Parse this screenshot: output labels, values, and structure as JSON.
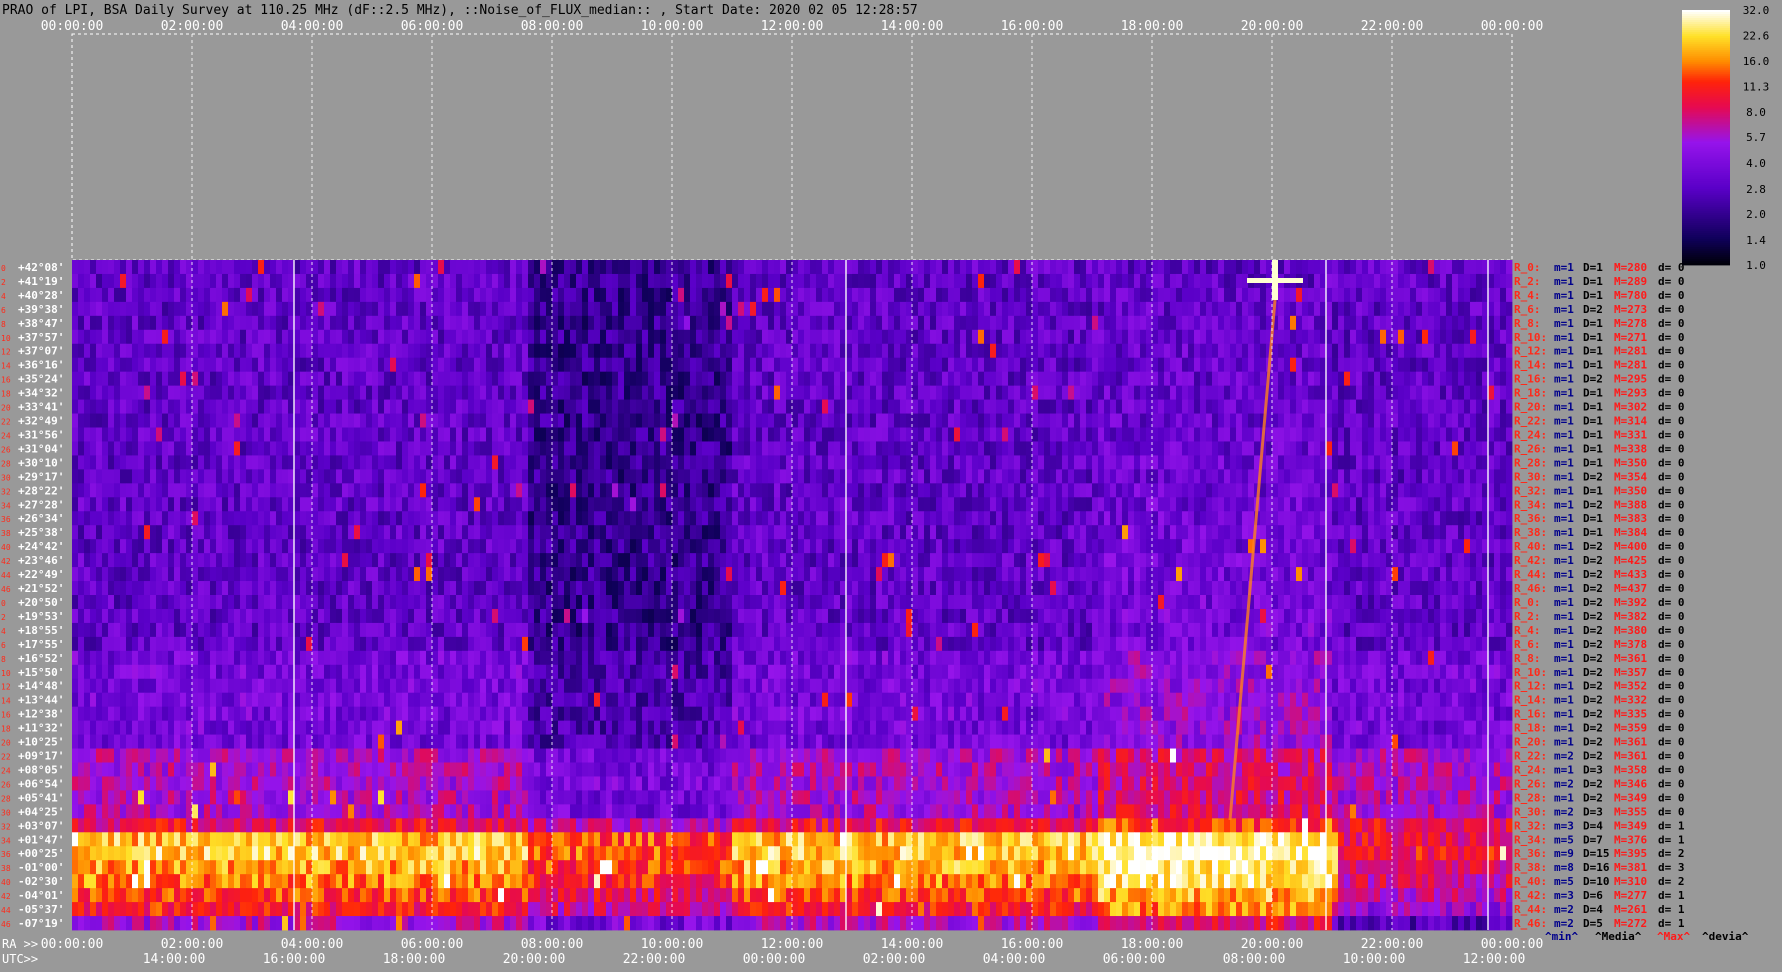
{
  "chart_data": {
    "type": "heatmap",
    "title": "PRAO of LPI, BSA Daily Survey at 110.25 MHz (dF::2.5 MHz), ::Noise_of_FLUX_median:: , Start Date: 2020 02 05 12:28:57",
    "ra_axis_label": "RA >>",
    "utc_axis_label": "UTC>>",
    "x_ticks_top": [
      "00:00:00",
      "02:00:00",
      "04:00:00",
      "06:00:00",
      "08:00:00",
      "10:00:00",
      "12:00:00",
      "14:00:00",
      "16:00:00",
      "18:00:00",
      "20:00:00",
      "22:00:00",
      "00:00:00"
    ],
    "x_ticks_ra": [
      "00:00:00",
      "02:00:00",
      "04:00:00",
      "06:00:00",
      "08:00:00",
      "10:00:00",
      "12:00:00",
      "14:00:00",
      "16:00:00",
      "18:00:00",
      "20:00:00",
      "22:00:00",
      "00:00:00"
    ],
    "x_ticks_utc": [
      "14:00:00",
      "16:00:00",
      "18:00:00",
      "20:00:00",
      "22:00:00",
      "00:00:00",
      "02:00:00",
      "04:00:00",
      "06:00:00",
      "08:00:00",
      "10:00:00",
      "12:00:00"
    ],
    "ra_range_hours": [
      0,
      24
    ],
    "colorbar": {
      "ticks": [
        "32.0",
        "22.6",
        "16.0",
        "11.3",
        "8.0",
        "5.7",
        "4.0",
        "2.8",
        "2.0",
        "1.4",
        "1.0"
      ],
      "range": [
        1.0,
        32.0
      ],
      "scale": "log"
    },
    "rows": [
      {
        "idx": "0",
        "dec": "+42°08'",
        "name": "R_0:",
        "m": "m=1",
        "D": "D=1",
        "M": "M=280",
        "d": "d= 0"
      },
      {
        "idx": "2",
        "dec": "+41°19'",
        "name": "R_2:",
        "m": "m=1",
        "D": "D=1",
        "M": "M=289",
        "d": "d= 0"
      },
      {
        "idx": "4",
        "dec": "+40°28'",
        "name": "R_4:",
        "m": "m=1",
        "D": "D=1",
        "M": "M=780",
        "d": "d= 0"
      },
      {
        "idx": "6",
        "dec": "+39°38'",
        "name": "R_6:",
        "m": "m=1",
        "D": "D=2",
        "M": "M=273",
        "d": "d= 0"
      },
      {
        "idx": "8",
        "dec": "+38°47'",
        "name": "R_8:",
        "m": "m=1",
        "D": "D=1",
        "M": "M=278",
        "d": "d= 0"
      },
      {
        "idx": "10",
        "dec": "+37°57'",
        "name": "R_10:",
        "m": "m=1",
        "D": "D=1",
        "M": "M=271",
        "d": "d= 0"
      },
      {
        "idx": "12",
        "dec": "+37°07'",
        "name": "R_12:",
        "m": "m=1",
        "D": "D=1",
        "M": "M=281",
        "d": "d= 0"
      },
      {
        "idx": "14",
        "dec": "+36°16'",
        "name": "R_14:",
        "m": "m=1",
        "D": "D=1",
        "M": "M=281",
        "d": "d= 0"
      },
      {
        "idx": "16",
        "dec": "+35°24'",
        "name": "R_16:",
        "m": "m=1",
        "D": "D=2",
        "M": "M=295",
        "d": "d= 0"
      },
      {
        "idx": "18",
        "dec": "+34°32'",
        "name": "R_18:",
        "m": "m=1",
        "D": "D=1",
        "M": "M=293",
        "d": "d= 0"
      },
      {
        "idx": "20",
        "dec": "+33°41'",
        "name": "R_20:",
        "m": "m=1",
        "D": "D=1",
        "M": "M=302",
        "d": "d= 0"
      },
      {
        "idx": "22",
        "dec": "+32°49'",
        "name": "R_22:",
        "m": "m=1",
        "D": "D=1",
        "M": "M=314",
        "d": "d= 0"
      },
      {
        "idx": "24",
        "dec": "+31°56'",
        "name": "R_24:",
        "m": "m=1",
        "D": "D=1",
        "M": "M=331",
        "d": "d= 0"
      },
      {
        "idx": "26",
        "dec": "+31°04'",
        "name": "R_26:",
        "m": "m=1",
        "D": "D=1",
        "M": "M=338",
        "d": "d= 0"
      },
      {
        "idx": "28",
        "dec": "+30°10'",
        "name": "R_28:",
        "m": "m=1",
        "D": "D=1",
        "M": "M=350",
        "d": "d= 0"
      },
      {
        "idx": "30",
        "dec": "+29°17'",
        "name": "R_30:",
        "m": "m=1",
        "D": "D=2",
        "M": "M=354",
        "d": "d= 0"
      },
      {
        "idx": "32",
        "dec": "+28°22'",
        "name": "R_32:",
        "m": "m=1",
        "D": "D=1",
        "M": "M=350",
        "d": "d= 0"
      },
      {
        "idx": "34",
        "dec": "+27°28'",
        "name": "R_34:",
        "m": "m=1",
        "D": "D=2",
        "M": "M=388",
        "d": "d= 0"
      },
      {
        "idx": "36",
        "dec": "+26°34'",
        "name": "R_36:",
        "m": "m=1",
        "D": "D=1",
        "M": "M=383",
        "d": "d= 0"
      },
      {
        "idx": "38",
        "dec": "+25°38'",
        "name": "R_38:",
        "m": "m=1",
        "D": "D=1",
        "M": "M=384",
        "d": "d= 0"
      },
      {
        "idx": "40",
        "dec": "+24°42'",
        "name": "R_40:",
        "m": "m=1",
        "D": "D=2",
        "M": "M=400",
        "d": "d= 0"
      },
      {
        "idx": "42",
        "dec": "+23°46'",
        "name": "R_42:",
        "m": "m=1",
        "D": "D=2",
        "M": "M=425",
        "d": "d= 0"
      },
      {
        "idx": "44",
        "dec": "+22°49'",
        "name": "R_44:",
        "m": "m=1",
        "D": "D=2",
        "M": "M=433",
        "d": "d= 0"
      },
      {
        "idx": "46",
        "dec": "+21°52'",
        "name": "R_46:",
        "m": "m=1",
        "D": "D=2",
        "M": "M=437",
        "d": "d= 0"
      },
      {
        "idx": "0",
        "dec": "+20°50'",
        "name": "R_0:",
        "m": "m=1",
        "D": "D=2",
        "M": "M=392",
        "d": "d= 0"
      },
      {
        "idx": "2",
        "dec": "+19°53'",
        "name": "R_2:",
        "m": "m=1",
        "D": "D=2",
        "M": "M=382",
        "d": "d= 0"
      },
      {
        "idx": "4",
        "dec": "+18°55'",
        "name": "R_4:",
        "m": "m=1",
        "D": "D=2",
        "M": "M=380",
        "d": "d= 0"
      },
      {
        "idx": "6",
        "dec": "+17°55'",
        "name": "R_6:",
        "m": "m=1",
        "D": "D=2",
        "M": "M=378",
        "d": "d= 0"
      },
      {
        "idx": "8",
        "dec": "+16°52'",
        "name": "R_8:",
        "m": "m=1",
        "D": "D=2",
        "M": "M=361",
        "d": "d= 0"
      },
      {
        "idx": "10",
        "dec": "+15°50'",
        "name": "R_10:",
        "m": "m=1",
        "D": "D=2",
        "M": "M=357",
        "d": "d= 0"
      },
      {
        "idx": "12",
        "dec": "+14°48'",
        "name": "R_12:",
        "m": "m=1",
        "D": "D=2",
        "M": "M=352",
        "d": "d= 0"
      },
      {
        "idx": "14",
        "dec": "+13°44'",
        "name": "R_14:",
        "m": "m=1",
        "D": "D=2",
        "M": "M=332",
        "d": "d= 0"
      },
      {
        "idx": "16",
        "dec": "+12°38'",
        "name": "R_16:",
        "m": "m=1",
        "D": "D=2",
        "M": "M=335",
        "d": "d= 0"
      },
      {
        "idx": "18",
        "dec": "+11°32'",
        "name": "R_18:",
        "m": "m=1",
        "D": "D=2",
        "M": "M=359",
        "d": "d= 0"
      },
      {
        "idx": "20",
        "dec": "+10°25'",
        "name": "R_20:",
        "m": "m=1",
        "D": "D=2",
        "M": "M=361",
        "d": "d= 0"
      },
      {
        "idx": "22",
        "dec": "+09°17'",
        "name": "R_22:",
        "m": "m=2",
        "D": "D=2",
        "M": "M=361",
        "d": "d= 0"
      },
      {
        "idx": "24",
        "dec": "+08°05'",
        "name": "R_24:",
        "m": "m=1",
        "D": "D=3",
        "M": "M=358",
        "d": "d= 0"
      },
      {
        "idx": "26",
        "dec": "+06°54'",
        "name": "R_26:",
        "m": "m=2",
        "D": "D=2",
        "M": "M=346",
        "d": "d= 0"
      },
      {
        "idx": "28",
        "dec": "+05°41'",
        "name": "R_28:",
        "m": "m=1",
        "D": "D=2",
        "M": "M=349",
        "d": "d= 0"
      },
      {
        "idx": "30",
        "dec": "+04°25'",
        "name": "R_30:",
        "m": "m=2",
        "D": "D=3",
        "M": "M=355",
        "d": "d= 0"
      },
      {
        "idx": "32",
        "dec": "+03°07'",
        "name": "R_32:",
        "m": "m=3",
        "D": "D=4",
        "M": "M=349",
        "d": "d= 1"
      },
      {
        "idx": "34",
        "dec": "+01°47'",
        "name": "R_34:",
        "m": "m=5",
        "D": "D=7",
        "M": "M=376",
        "d": "d= 1"
      },
      {
        "idx": "36",
        "dec": "+00°25'",
        "name": "R_36:",
        "m": "m=9",
        "D": "D=15",
        "M": "M=395",
        "d": "d= 2"
      },
      {
        "idx": "38",
        "dec": "-01°00'",
        "name": "R_38:",
        "m": "m=8",
        "D": "D=16",
        "M": "M=381",
        "d": "d= 3"
      },
      {
        "idx": "40",
        "dec": "-02°30'",
        "name": "R_40:",
        "m": "m=5",
        "D": "D=10",
        "M": "M=310",
        "d": "d= 2"
      },
      {
        "idx": "42",
        "dec": "-04°01'",
        "name": "R_42:",
        "m": "m=3",
        "D": "D=6",
        "M": "M=277",
        "d": "d= 1"
      },
      {
        "idx": "44",
        "dec": "-05°37'",
        "name": "R_44:",
        "m": "m=2",
        "D": "D=4",
        "M": "M=261",
        "d": "d= 1"
      },
      {
        "idx": "46",
        "dec": "-07°19'",
        "name": "R_46:",
        "m": "m=2",
        "D": "D=5",
        "M": "M=272",
        "d": "d= 1"
      }
    ],
    "stats_legend": [
      "^min^",
      "^Media^",
      "^Max^",
      "^devia^"
    ],
    "colors": {
      "background": "#999999",
      "title_text": "#000000",
      "axis_text": "#ffffff",
      "row_name": "#ff2a1a",
      "stat_blue": "#00008b",
      "stat_red": "#ff1a1a",
      "stat_black": "#000000"
    }
  }
}
